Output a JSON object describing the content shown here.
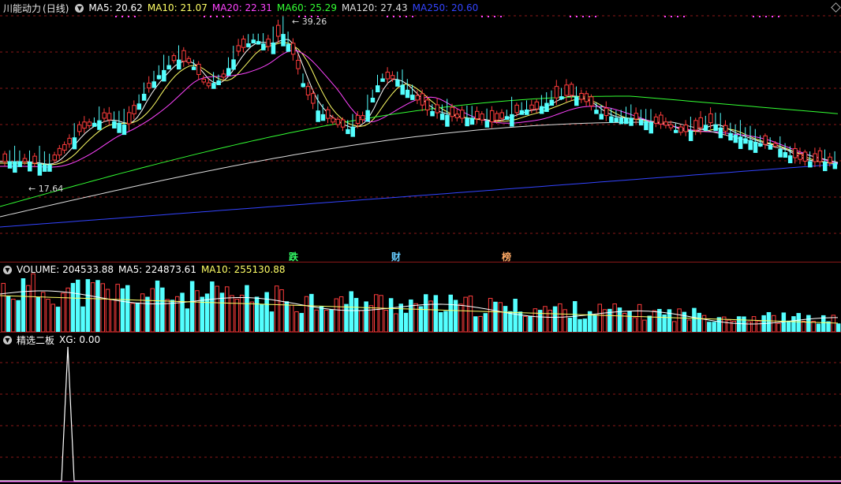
{
  "symbol": "川能动力",
  "period": "(日线)",
  "price_legend": [
    {
      "label": "MA5: 20.62",
      "color": "#ffffff"
    },
    {
      "label": "MA10: 21.07",
      "color": "#ffff66"
    },
    {
      "label": "MA20: 22.31",
      "color": "#ff44ff"
    },
    {
      "label": "MA60: 25.29",
      "color": "#33ff33"
    },
    {
      "label": "MA120: 27.43",
      "color": "#dddddd"
    },
    {
      "label": "MA250: 20.60",
      "color": "#3344ff"
    }
  ],
  "annotations": {
    "high": "39.26",
    "low": "17.64"
  },
  "markers": [
    {
      "text": "跌",
      "color": "#33ff66"
    },
    {
      "text": "财",
      "color": "#66ccff"
    },
    {
      "text": "榜",
      "color": "#ffaa66"
    }
  ],
  "volume_legend": [
    {
      "label": "VOLUME: 204533.88",
      "color": "#ffffff"
    },
    {
      "label": "MA5: 224873.61",
      "color": "#ffffff"
    },
    {
      "label": "MA10: 255130.88",
      "color": "#ffff66"
    }
  ],
  "indicator_legend": {
    "name": "精选二板",
    "value": "XG: 0.00"
  },
  "colors": {
    "up": "#ff3c3c",
    "down": "#54ffff",
    "grid": "#8a1818",
    "bg": "#000000"
  }
}
